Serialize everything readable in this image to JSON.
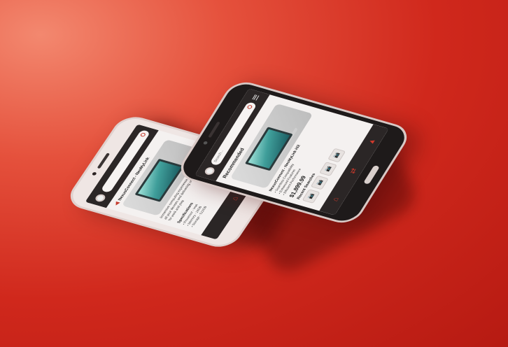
{
  "phone_front": {
    "search": {
      "placeholder": "Search..."
    },
    "section_title": "Recommended",
    "product": {
      "name": "NexusConnect - NeoMyLink Hi2",
      "specs": [
        "• Seamless Compatibility",
        "• Enhanced Features",
        "• Efficient Performance"
      ],
      "price": "$1,899.99"
    },
    "recent_title": "Recent Searches",
    "recent_icons": [
      "camera-icon",
      "camera-icon",
      "camera-icon",
      "camera-icon"
    ]
  },
  "phone_back": {
    "search": {
      "placeholder": ""
    },
    "product_title": "NexusConnect - NeoMyLink",
    "description": "Immersive computing experience, seamlessly connecting all your devices and delivering unparalleled performance for work and play.",
    "specs_title": "Specifications",
    "specs": [
      "• Processor - Intel",
      "• Memory - 16GB",
      "• Storage - 512GB"
    ]
  },
  "colors": {
    "accent": "#c43b2d",
    "bar": "#2b2626",
    "background": "#d0281c"
  }
}
